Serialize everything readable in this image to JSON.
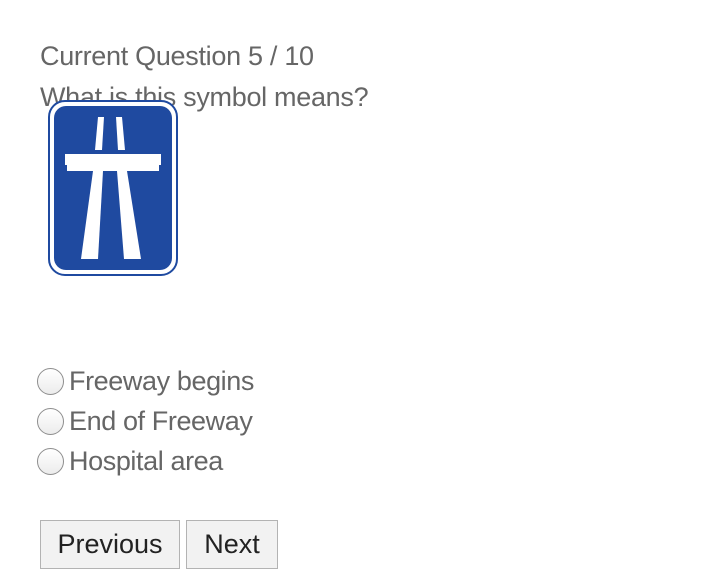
{
  "quiz": {
    "counter": "Current Question 5 / 10",
    "question": "What is this symbol means?",
    "image_icon": "freeway-sign-icon",
    "options": [
      {
        "label": "Freeway begins",
        "checked": false
      },
      {
        "label": "End of Freeway",
        "checked": false
      },
      {
        "label": "Hospital area",
        "checked": false
      }
    ],
    "buttons": {
      "previous_label": "Previous",
      "next_label": "Next"
    }
  },
  "colors": {
    "sign_blue": "#1f4aa0",
    "sign_white": "#ffffff",
    "text": "#666666",
    "button_bg": "#f2f2f2"
  }
}
